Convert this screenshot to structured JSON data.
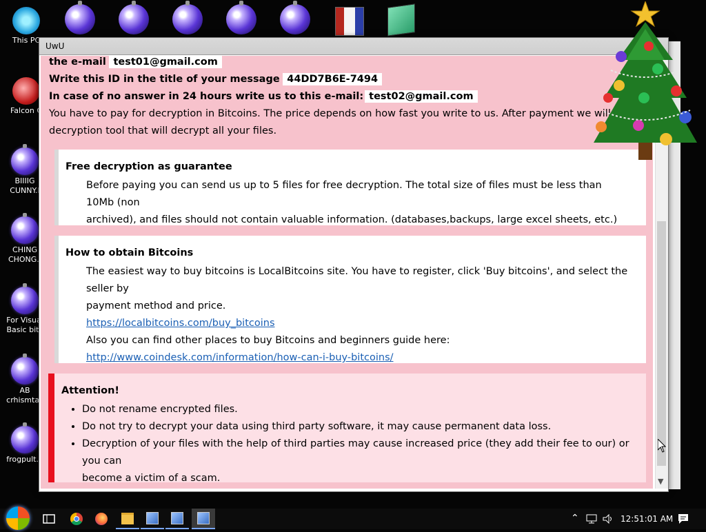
{
  "desktop": {
    "icons": [
      {
        "label": "This PC"
      },
      {
        "label": "Falcon C"
      },
      {
        "label": "BIIIIG CUNNY.I"
      },
      {
        "label": "CHING CHONG.I"
      },
      {
        "label": "For Visual Basic bitc"
      },
      {
        "label": "AB crhismtas"
      },
      {
        "label": "frogpult.e"
      }
    ]
  },
  "window": {
    "title": "UwU",
    "header": {
      "email_prefix": "the e-mail",
      "email1": "test01@gmail.com",
      "id_prefix": "Write this ID in the title of your message",
      "id_value": "44DD7B6E-7494",
      "noanswer_prefix": "In case of no answer in 24 hours write us to this e-mail:",
      "email2": "test02@gmail.com",
      "pay_text": "You have to pay for decryption in Bitcoins. The price depends on how fast you write to us. After payment we will send you the",
      "pay_text2": "decryption tool that will decrypt all your files."
    },
    "free_box": {
      "title": "Free decryption as guarantee",
      "text1": "Before paying you can send us up to 5 files for free decryption. The total size of files must be less than 10Mb (non",
      "text2": "archived), and files should not contain valuable information. (databases,backups, large excel sheets, etc.)"
    },
    "bitcoin_box": {
      "title": "How to obtain Bitcoins",
      "text1": "The easiest way to buy bitcoins is LocalBitcoins site. You have to register, click 'Buy bitcoins', and select the seller by",
      "text2": "payment method and price.",
      "link1": "https://localbitcoins.com/buy_bitcoins",
      "text3": "Also you can find other places to buy Bitcoins and beginners guide here:",
      "link2": "http://www.coindesk.com/information/how-can-i-buy-bitcoins/"
    },
    "attention_box": {
      "title": "Attention!",
      "items": [
        "Do not rename encrypted files.",
        "Do not try to decrypt your data using third party software, it may cause permanent data loss.",
        "Decryption of your files with the help of third parties may cause increased price (they add their fee to our) or you can",
        "become a victim of a scam."
      ]
    }
  },
  "taskbar": {
    "clock": "12:51:01 AM"
  },
  "colors": {
    "content_bg": "#f7c2cc",
    "attention_bar": "#e8101e",
    "link": "#1a5fb4"
  }
}
